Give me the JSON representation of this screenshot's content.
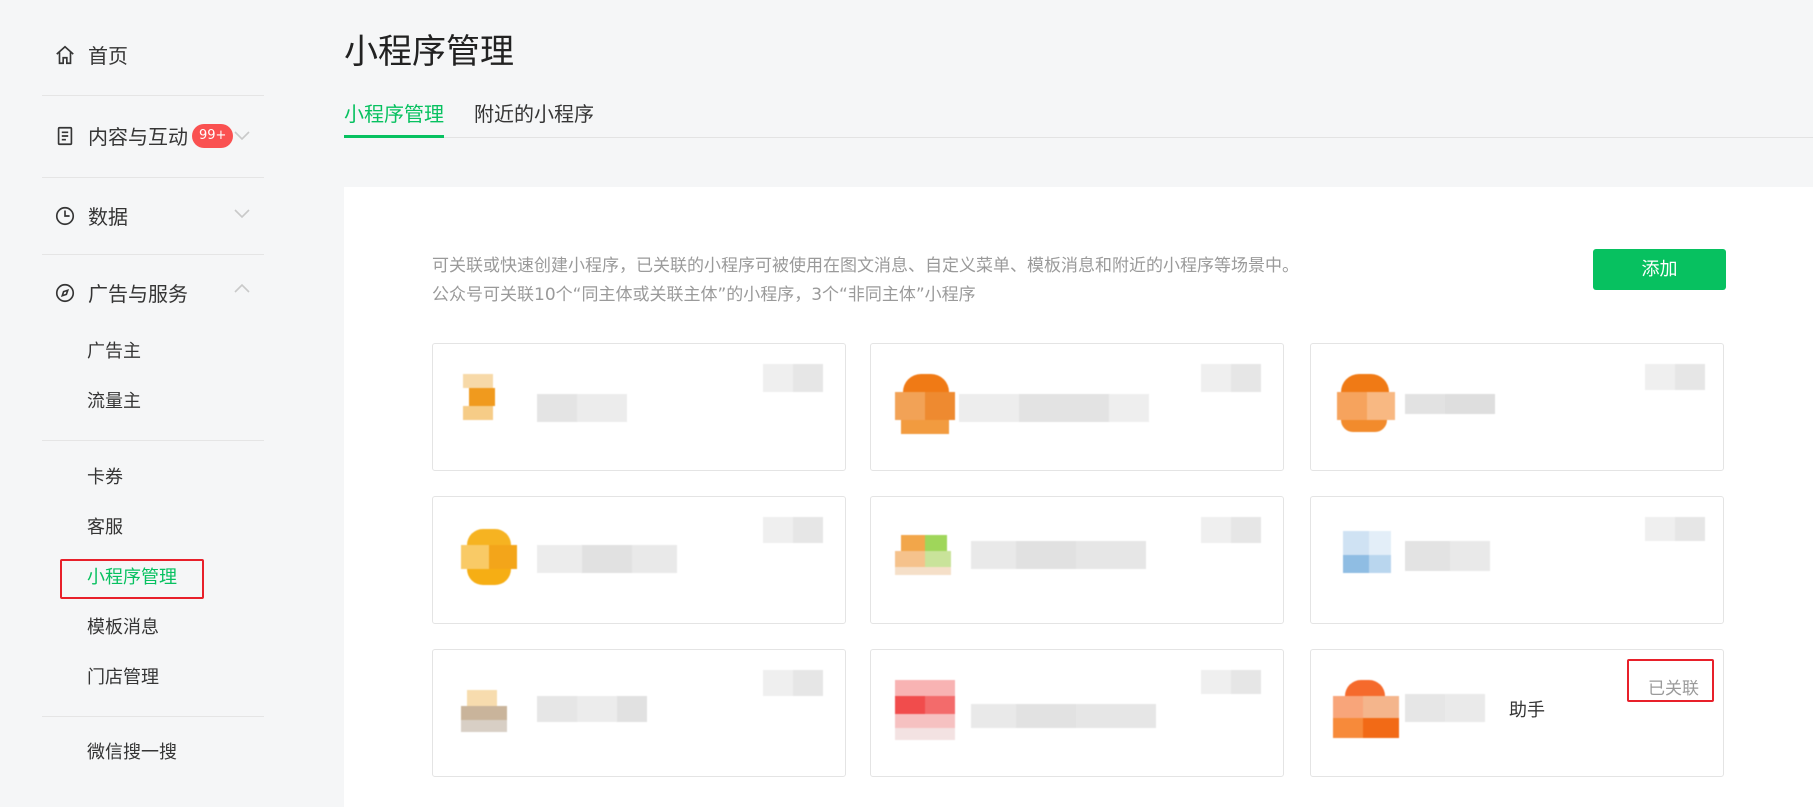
{
  "sidebar": {
    "home": "首页",
    "content": "内容与互动",
    "content_badge": "99+",
    "data": "数据",
    "ads": "广告与服务",
    "sub_ads": [
      "广告主",
      "流量主"
    ],
    "sub_services": [
      "卡券",
      "客服",
      "小程序管理",
      "模板消息",
      "门店管理"
    ],
    "search": "微信搜一搜",
    "icons": [
      "home-icon",
      "document-icon",
      "clock-icon",
      "compass-icon",
      "chevron-down-icon",
      "chevron-up-icon"
    ]
  },
  "main": {
    "title": "小程序管理",
    "tabs": [
      "小程序管理",
      "附近的小程序"
    ],
    "description_line1": "可关联或快速创建小程序，已关联的小程序可被使用在图文消息、自定义菜单、模板消息和附近的小程序等场景中。",
    "description_line2": "公众号可关联10个“同主体或关联主体”的小程序，3个“非同主体”小程序",
    "add_button": "添加",
    "last_card_status": "已关联",
    "last_card_name_suffix": "助手"
  },
  "colors": {
    "accent": "#07c160",
    "badge": "#fa5151",
    "highlight": "#e8202a"
  }
}
